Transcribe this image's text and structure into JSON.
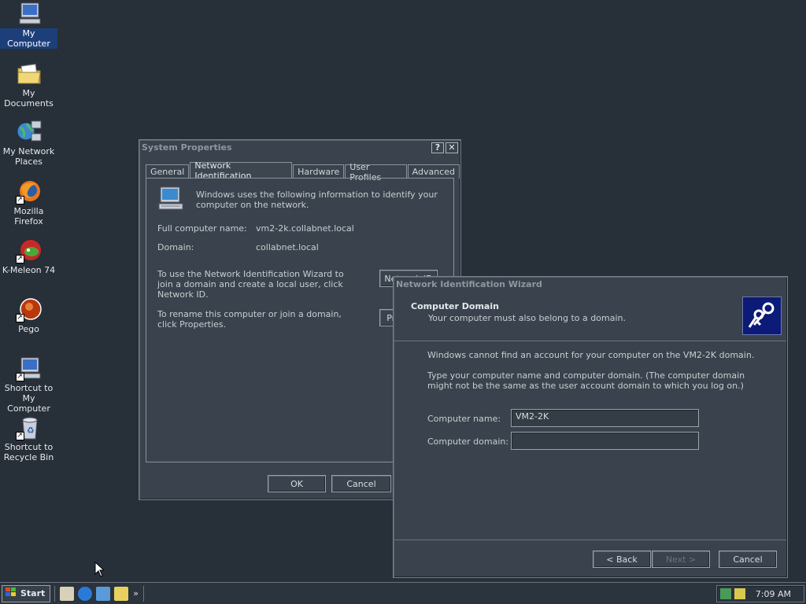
{
  "desktop": {
    "icons": [
      {
        "label": "My Computer"
      },
      {
        "label": "My Documents"
      },
      {
        "label": "My Network Places"
      },
      {
        "label": "Mozilla Firefox"
      },
      {
        "label": "K-Meleon 74"
      },
      {
        "label": "Pego"
      },
      {
        "label": "Shortcut to My Computer"
      },
      {
        "label": "Shortcut to Recycle Bin"
      }
    ]
  },
  "system_properties": {
    "title": "System Properties",
    "help_label": "?",
    "close_label": "✕",
    "tabs": [
      {
        "label": "General"
      },
      {
        "label": "Network Identification"
      },
      {
        "label": "Hardware"
      },
      {
        "label": "User Profiles"
      },
      {
        "label": "Advanced"
      }
    ],
    "intro": "Windows uses the following information to identify your computer on the network.",
    "full_name_label": "Full computer name:",
    "full_name_value": "vm2-2k.collabnet.local",
    "domain_label": "Domain:",
    "domain_value": "collabnet.local",
    "wizard_text": "To use the Network Identification Wizard to join a domain and create a local user, click Network ID.",
    "network_id_button": "Network ID",
    "rename_text": "To rename this computer or join a domain, click Properties.",
    "properties_button": "Properties",
    "ok_label": "OK",
    "cancel_label": "Cancel"
  },
  "wizard": {
    "title": "Network Identification Wizard",
    "header_title": "Computer Domain",
    "header_subtitle": "Your computer must also belong to a domain.",
    "message1": "Windows cannot find an account for your computer on the VM2-2K domain.",
    "message2": "Type your computer name and computer domain. (The computer domain might not be the same as the user account domain to which you log on.)",
    "computer_name_label": "Computer name:",
    "computer_name_value": "VM2-2K",
    "computer_domain_label": "Computer domain:",
    "computer_domain_value": "",
    "back_label": "< Back",
    "next_label": "Next >",
    "cancel_label": "Cancel"
  },
  "taskbar": {
    "start_label": "Start",
    "chevron": "»",
    "clock": "7:09 AM"
  }
}
